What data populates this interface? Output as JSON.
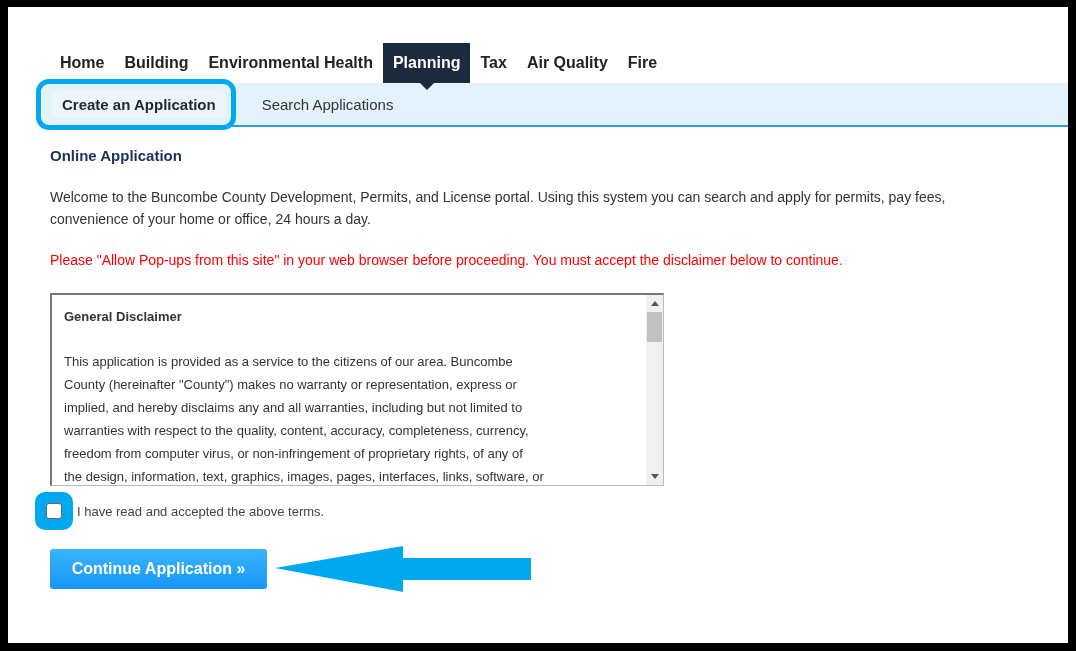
{
  "nav": {
    "tabs": [
      {
        "label": "Home",
        "selected": false
      },
      {
        "label": "Building",
        "selected": false
      },
      {
        "label": "Environmental Health",
        "selected": false
      },
      {
        "label": "Planning",
        "selected": true
      },
      {
        "label": "Tax",
        "selected": false
      },
      {
        "label": "Air Quality",
        "selected": false
      },
      {
        "label": "Fire",
        "selected": false
      }
    ]
  },
  "subnav": {
    "items": [
      {
        "label": "Create an Application",
        "selected": true
      },
      {
        "label": "Search Applications",
        "selected": false
      }
    ]
  },
  "heading": "Online Application",
  "welcome_lines": [
    "Welcome to the Buncombe County Development, Permits, and License portal. Using this system you can search and apply for permits, pay fees,",
    "convenience of your home or office, 24 hours a day."
  ],
  "notice": "Please \"Allow Pop-ups from this site\" in your web browser before proceeding. You must accept the disclaimer below to continue.",
  "disclaimer": {
    "title": "General Disclaimer",
    "lines": [
      "This application is provided as a service to the citizens of our area.  Buncombe",
      "County (hereinafter \"County\") makes no warranty or representation, express or",
      "implied, and hereby disclaims any and all warranties, including but not limited to",
      "warranties with respect to the quality, content, accuracy, completeness, currency,",
      "freedom from computer virus, or non-infringement of proprietary rights, of any of",
      "the design, information, text, graphics, images, pages, interfaces, links, software, or"
    ]
  },
  "accept": {
    "label": "I have read and accepted the above terms.",
    "checked": false
  },
  "continue_button": "Continue Application »"
}
